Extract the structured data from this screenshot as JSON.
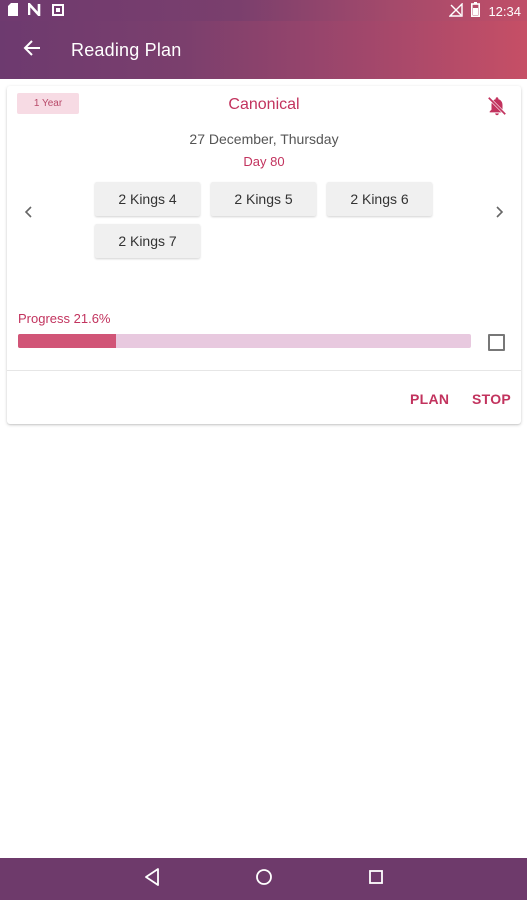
{
  "status_bar": {
    "time": "12:34",
    "left_icons": [
      "sd-card-icon",
      "n-notification-icon",
      "square-notification-icon"
    ],
    "right_icons": [
      "signal-off-icon",
      "battery-icon"
    ]
  },
  "app_bar": {
    "title": "Reading Plan",
    "back_icon": "arrow-back-icon"
  },
  "plan_card": {
    "badge": "1 Year",
    "title": "Canonical",
    "date": "27 December, Thursday",
    "day": "Day 80",
    "chapters": [
      "2 Kings 4",
      "2 Kings 5",
      "2 Kings 6",
      "2 Kings 7"
    ],
    "progress_label": "Progress 21.6%",
    "progress_value": 0.216,
    "completed": false,
    "actions": {
      "plan": "PLAN",
      "stop": "STOP"
    }
  },
  "colors": {
    "accent": "#c2335e",
    "progress_fill": "#d15577",
    "progress_track": "#e8c9df",
    "nav_bar": "#6e3a6b"
  },
  "nav_bar": {
    "buttons": [
      "back-triangle-icon",
      "home-circle-icon",
      "recents-square-icon"
    ]
  }
}
